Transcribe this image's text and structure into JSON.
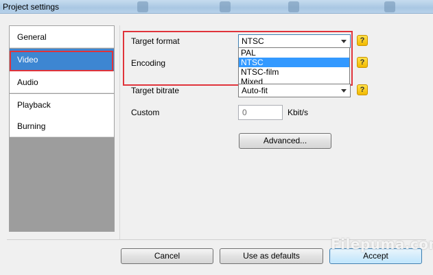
{
  "window": {
    "title": "Project settings"
  },
  "sidebar": {
    "items": [
      {
        "label": "General",
        "selected": false
      },
      {
        "label": "Video",
        "selected": true
      },
      {
        "label": "Audio",
        "selected": false
      },
      {
        "label": "Playback",
        "selected": false
      },
      {
        "label": "Burning",
        "selected": false
      }
    ]
  },
  "video": {
    "target_format": {
      "label": "Target format",
      "value": "NTSC",
      "options": [
        "PAL",
        "NTSC",
        "NTSC-film",
        "Mixed"
      ],
      "highlighted_option": "NTSC"
    },
    "encoding": {
      "label": "Encoding"
    },
    "target_bitrate": {
      "label": "Target bitrate",
      "value": "Auto-fit"
    },
    "custom": {
      "label": "Custom",
      "value": "0",
      "unit": "Kbit/s"
    },
    "advanced_button": "Advanced...",
    "help_icon": "?"
  },
  "footer": {
    "cancel": "Cancel",
    "use_defaults": "Use as defaults",
    "accept": "Accept"
  },
  "watermark": "Filepuma.com",
  "colors": {
    "selection": "#3d86d2",
    "annotation_red": "#e0333a",
    "help_yellow": "#f2b900"
  },
  "icons": {
    "help": "question-mark-icon",
    "dropdown": "chevron-down-icon"
  }
}
